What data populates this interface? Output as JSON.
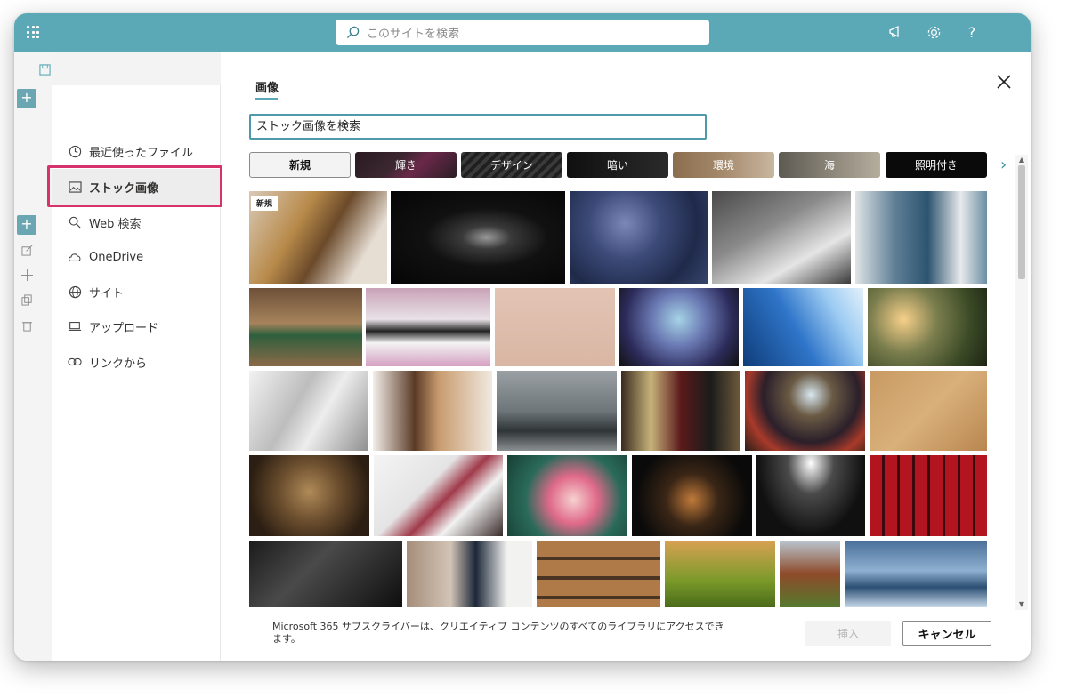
{
  "topbar": {
    "search_placeholder": "このサイトを検索",
    "icons": [
      "app-launcher-icon",
      "megaphone-icon",
      "gear-icon",
      "help-icon"
    ],
    "help_label": "?"
  },
  "nav": {
    "items": [
      {
        "label": "最近使ったファイル",
        "icon": "clock-icon"
      },
      {
        "label": "ストック画像",
        "icon": "image-icon",
        "selected": true
      },
      {
        "label": "Web 検索",
        "icon": "search-icon"
      },
      {
        "label": "OneDrive",
        "icon": "cloud-icon"
      },
      {
        "label": "サイト",
        "icon": "globe-icon"
      },
      {
        "label": "アップロード",
        "icon": "laptop-icon"
      },
      {
        "label": "リンクから",
        "icon": "link-icon"
      }
    ]
  },
  "content": {
    "heading": "画像",
    "search_placeholder": "ストック画像を検索",
    "categories": [
      "新規",
      "輝き",
      "デザイン",
      "暗い",
      "環境",
      "海",
      "照明付き"
    ],
    "new_badge": "新規",
    "footer_text": "Microsoft 365 サブスクライバーは、クリエイティブ コンテンツのすべてのライブラリにアクセスできます。",
    "insert_label": "挿入",
    "cancel_label": "キャンセル"
  },
  "colors": {
    "topbar": "#5ba8b6",
    "accent": "#4e9aaa",
    "selection_highlight": "#d6336c"
  }
}
